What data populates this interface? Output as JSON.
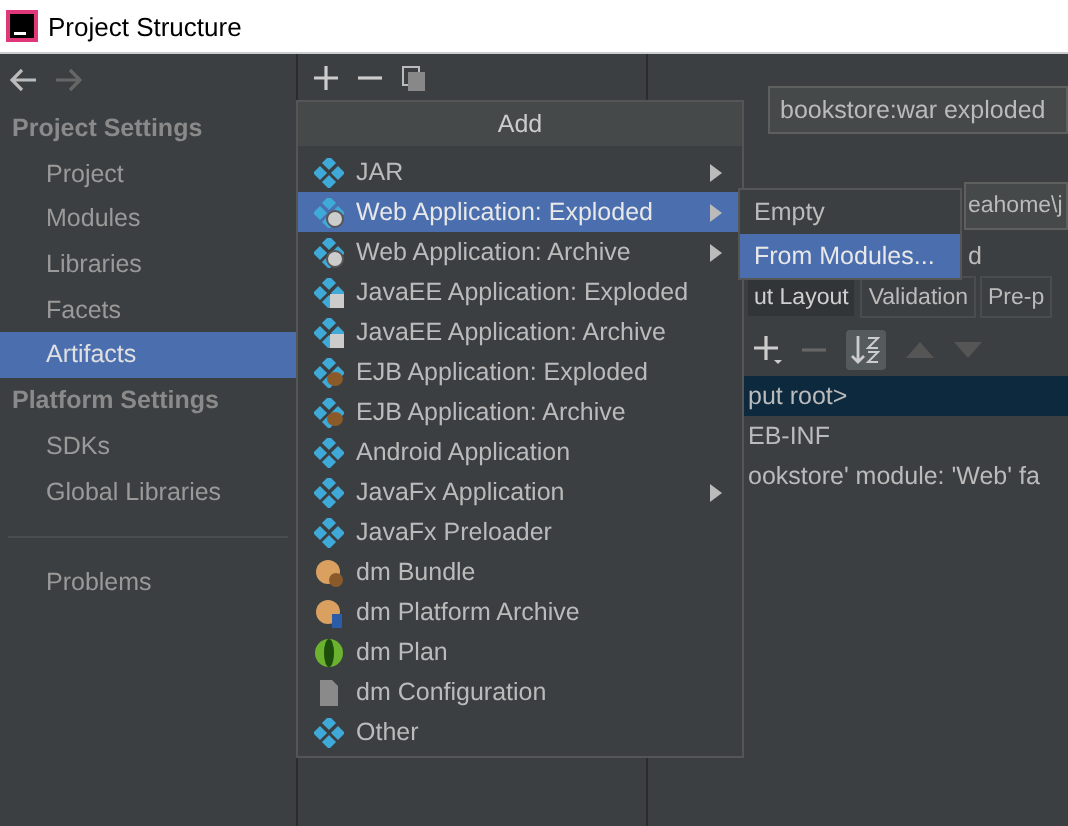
{
  "window": {
    "title": "Project Structure"
  },
  "sidebar": {
    "sections": [
      {
        "kind": "header",
        "label": "Project Settings"
      },
      {
        "kind": "item",
        "label": "Project",
        "selected": false
      },
      {
        "kind": "item",
        "label": "Modules",
        "selected": false
      },
      {
        "kind": "item",
        "label": "Libraries",
        "selected": false
      },
      {
        "kind": "item",
        "label": "Facets",
        "selected": false
      },
      {
        "kind": "item",
        "label": "Artifacts",
        "selected": true
      },
      {
        "kind": "header",
        "label": "Platform Settings"
      },
      {
        "kind": "item",
        "label": "SDKs",
        "selected": false
      },
      {
        "kind": "item",
        "label": "Global Libraries",
        "selected": false
      },
      {
        "kind": "separator"
      },
      {
        "kind": "item",
        "label": "Problems",
        "selected": false
      }
    ]
  },
  "details": {
    "name_field": "bookstore:war exploded",
    "path_field": "eahome\\j",
    "note": "d",
    "tabs": [
      {
        "label": "ut Layout",
        "selected": true
      },
      {
        "label": "Validation",
        "selected": false
      },
      {
        "label": "Pre-p",
        "selected": false
      }
    ],
    "tree": [
      {
        "label": "put root>",
        "selected": true
      },
      {
        "label": "EB-INF",
        "selected": false
      },
      {
        "label": "ookstore' module: 'Web' fa",
        "selected": false
      }
    ]
  },
  "add_menu": {
    "title": "Add",
    "items": [
      {
        "label": "JAR",
        "kind": "artifact",
        "submenu": true,
        "selected": false
      },
      {
        "label": "Web Application: Exploded",
        "kind": "web",
        "submenu": true,
        "selected": true
      },
      {
        "label": "Web Application: Archive",
        "kind": "web",
        "submenu": true,
        "selected": false
      },
      {
        "label": "JavaEE Application: Exploded",
        "kind": "javaee",
        "submenu": false,
        "selected": false
      },
      {
        "label": "JavaEE Application: Archive",
        "kind": "javaee",
        "submenu": false,
        "selected": false
      },
      {
        "label": "EJB Application: Exploded",
        "kind": "ejb",
        "submenu": false,
        "selected": false
      },
      {
        "label": "EJB Application: Archive",
        "kind": "ejb",
        "submenu": false,
        "selected": false
      },
      {
        "label": "Android Application",
        "kind": "artifact",
        "submenu": false,
        "selected": false
      },
      {
        "label": "JavaFx Application",
        "kind": "artifact",
        "submenu": true,
        "selected": false
      },
      {
        "label": "JavaFx Preloader",
        "kind": "artifact",
        "submenu": false,
        "selected": false
      },
      {
        "label": "dm Bundle",
        "kind": "bundle",
        "submenu": false,
        "selected": false
      },
      {
        "label": "dm Platform Archive",
        "kind": "platform",
        "submenu": false,
        "selected": false
      },
      {
        "label": "dm Plan",
        "kind": "plan",
        "submenu": false,
        "selected": false
      },
      {
        "label": "dm Configuration",
        "kind": "document",
        "submenu": false,
        "selected": false
      },
      {
        "label": "Other",
        "kind": "artifact",
        "submenu": false,
        "selected": false
      }
    ]
  },
  "submenu": {
    "items": [
      {
        "label": "Empty",
        "selected": false
      },
      {
        "label": "From Modules...",
        "selected": true
      }
    ]
  }
}
